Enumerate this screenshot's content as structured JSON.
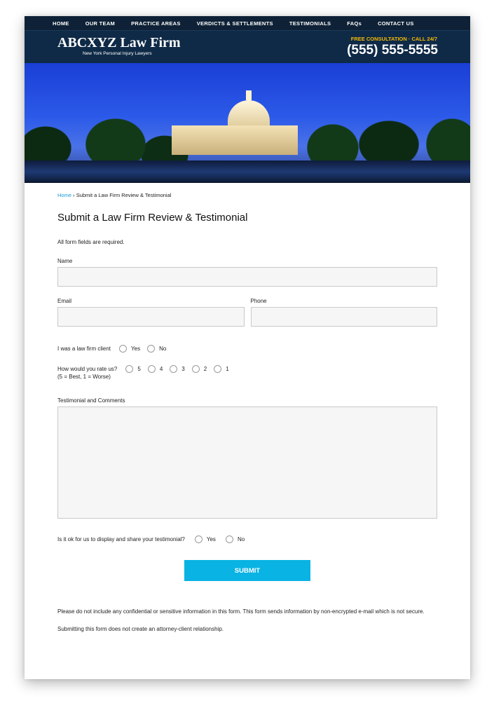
{
  "nav": {
    "items": [
      "HOME",
      "OUR TEAM",
      "PRACTICE AREAS",
      "VERDICTS & SETTLEMENTS",
      "TESTIMONIALS",
      "FAQs",
      "CONTACT US"
    ]
  },
  "header": {
    "firm_name": "ABCXYZ Law Firm",
    "tagline": "New York Personal Injury Lawyers",
    "consultation": "FREE CONSULTATION · CALL 24/7",
    "phone": "(555) 555-5555"
  },
  "breadcrumb": {
    "home": "Home",
    "separator": " › ",
    "current": "Submit a Law Firm Review & Testimonial"
  },
  "form": {
    "title": "Submit a Law Firm Review & Testimonial",
    "required_note": "All form fields are required.",
    "name_label": "Name",
    "email_label": "Email",
    "phone_label": "Phone",
    "client_question": "I was a law firm client",
    "client_options": [
      "Yes",
      "No"
    ],
    "rating_question": "How would you rate us?",
    "rating_hint": "(5 = Best, 1 = Worse)",
    "rating_options": [
      "5",
      "4",
      "3",
      "2",
      "1"
    ],
    "comments_label": "Testimonial and Comments",
    "share_question": "Is it ok for us to display and share your testimonial?",
    "share_options": [
      "Yes",
      "No"
    ],
    "submit_label": "SUBMIT"
  },
  "disclaimer": {
    "line1": "Please do not include any confidential or sensitive information in this form. This form sends information by non-encrypted e-mail which is not secure.",
    "line2": "Submitting this form does not create an attorney-client relationship."
  },
  "colors": {
    "nav_bg": "#0e2136",
    "header_bg": "#0f2a47",
    "accent_gold": "#f2b705",
    "submit_blue": "#09b3e3",
    "link_blue": "#1a9bd7"
  }
}
